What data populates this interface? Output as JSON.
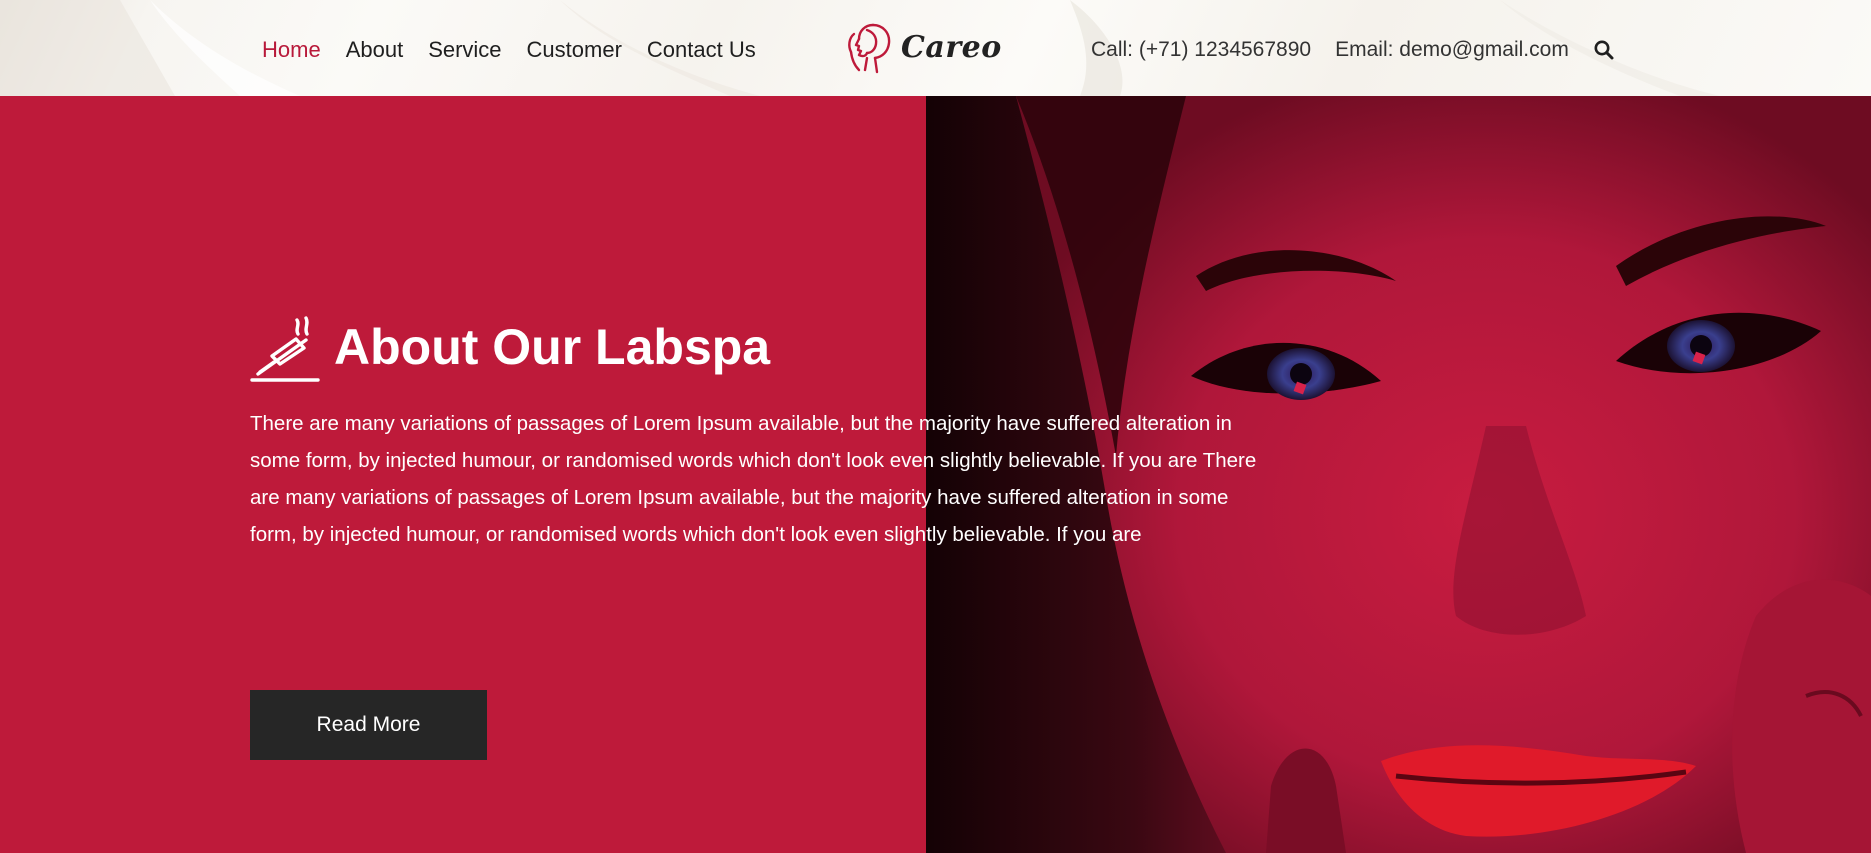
{
  "nav": {
    "items": [
      {
        "label": "Home",
        "active": true
      },
      {
        "label": "About",
        "active": false
      },
      {
        "label": "Service",
        "active": false
      },
      {
        "label": "Customer",
        "active": false
      },
      {
        "label": "Contact Us",
        "active": false
      }
    ]
  },
  "logo": {
    "text": "Careo",
    "icon": "woman-face-logo-icon"
  },
  "contact": {
    "phone": "Call: (+71) 1234567890",
    "email": "Email: demo@gmail.com",
    "search_icon": "search-icon"
  },
  "hero": {
    "icon": "incense-stick-icon",
    "title": "About Our Labspa",
    "description": "There are many variations of passages of Lorem Ipsum available, but the majority have suffered alteration in some form, by injected humour, or randomised words which don't look even slightly believable. If you are There are many variations of passages of Lorem Ipsum available, but the majority have suffered alteration in some form, by injected humour, or randomised words which don't look even slightly believable. If you are",
    "button_label": "Read More",
    "photo": "woman-face-red-tint-photo"
  },
  "colors": {
    "accent": "#be1a3a",
    "nav_active": "#b8193a",
    "button_bg": "#262626",
    "header_bg": "#f8f6f2",
    "text_dark": "#1f1f1f"
  }
}
